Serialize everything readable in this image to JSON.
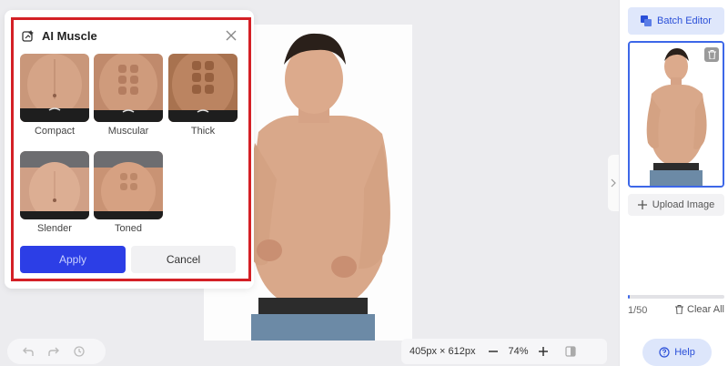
{
  "panel": {
    "title": "AI Muscle",
    "icon": "magic-edit-icon",
    "styles": [
      {
        "label": "Compact"
      },
      {
        "label": "Muscular"
      },
      {
        "label": "Thick"
      },
      {
        "label": "Slender"
      },
      {
        "label": "Toned"
      }
    ],
    "apply_label": "Apply",
    "cancel_label": "Cancel"
  },
  "canvas": {
    "dimensions": "405px × 612px",
    "zoom": "74%"
  },
  "sidebar": {
    "batch_label": "Batch Editor",
    "upload_label": "Upload Image",
    "count": "1/50",
    "clear_label": "Clear All",
    "help_label": "Help",
    "progress": 0.02
  },
  "colors": {
    "accent": "#2c3ee6",
    "highlight": "#d42026",
    "selection": "#3d67e8"
  }
}
